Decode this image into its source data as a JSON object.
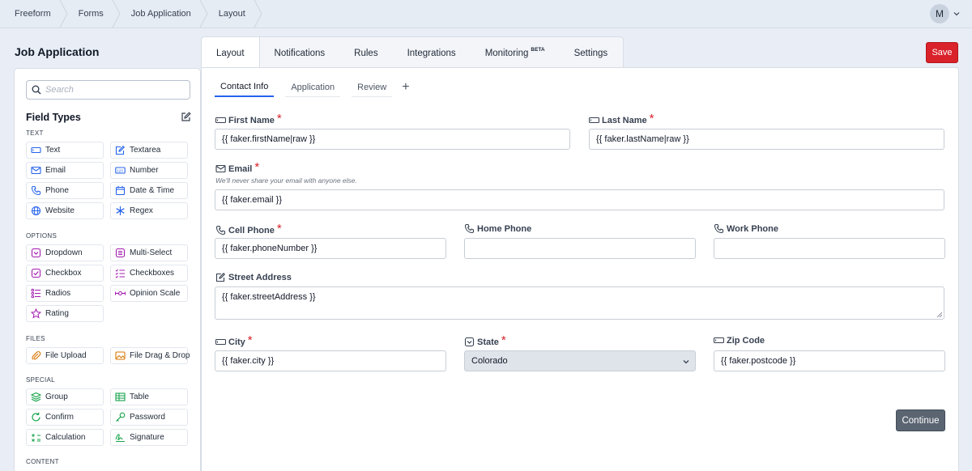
{
  "breadcrumb": [
    "Freeform",
    "Forms",
    "Job Application",
    "Layout"
  ],
  "user": {
    "avatar_initial": "M"
  },
  "page_title": "Job Application",
  "sidebar": {
    "search_placeholder": "Search",
    "field_types_title": "Field Types",
    "sections": {
      "text": "TEXT",
      "options": "OPTIONS",
      "files": "FILES",
      "special": "SPECIAL",
      "content": "CONTENT"
    },
    "fields": {
      "text": "Text",
      "textarea": "Textarea",
      "email": "Email",
      "number": "Number",
      "phone": "Phone",
      "datetime": "Date & Time",
      "website": "Website",
      "regex": "Regex",
      "dropdown": "Dropdown",
      "multiselect": "Multi-Select",
      "checkbox": "Checkbox",
      "checkboxes": "Checkboxes",
      "radios": "Radios",
      "opinion": "Opinion Scale",
      "rating": "Rating",
      "fileupload": "File Upload",
      "filedrag": "File Drag & Drop",
      "group": "Group",
      "table": "Table",
      "confirm": "Confirm",
      "password": "Password",
      "calculation": "Calculation",
      "signature": "Signature"
    }
  },
  "tabs": {
    "layout": "Layout",
    "notifications": "Notifications",
    "rules": "Rules",
    "integrations": "Integrations",
    "monitoring": "Monitoring",
    "monitoring_badge": "BETA",
    "settings": "Settings"
  },
  "save_label": "Save",
  "subtabs": {
    "contact": "Contact Info",
    "application": "Application",
    "review": "Review",
    "add": "+"
  },
  "form": {
    "first_name": {
      "label": "First Name",
      "value": "{{ faker.firstName|raw }}"
    },
    "last_name": {
      "label": "Last Name",
      "value": "{{ faker.lastName|raw }}"
    },
    "email": {
      "label": "Email",
      "hint": "We'll never share your email with anyone else.",
      "value": "{{ faker.email }}"
    },
    "cell_phone": {
      "label": "Cell Phone",
      "value": "{{ faker.phoneNumber }}"
    },
    "home_phone": {
      "label": "Home Phone",
      "value": ""
    },
    "work_phone": {
      "label": "Work Phone",
      "value": ""
    },
    "street": {
      "label": "Street Address",
      "value": "{{ faker.streetAddress }}"
    },
    "city": {
      "label": "City",
      "value": "{{ faker.city }}"
    },
    "state": {
      "label": "State",
      "value": "Colorado"
    },
    "zip": {
      "label": "Zip Code",
      "value": "{{ faker.postcode }}"
    },
    "required_mark": "*"
  },
  "continue_label": "Continue",
  "colors": {
    "accent": "#2563eb",
    "save": "#d9222a",
    "required": "#d9222a",
    "continue": "#5b6572"
  }
}
